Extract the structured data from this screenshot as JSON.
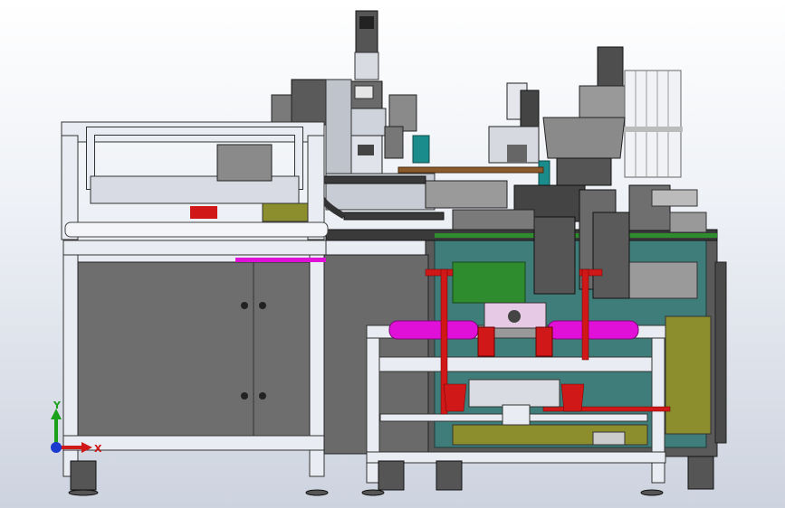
{
  "view": {
    "axis_y_label": "Y",
    "axis_x_label": "X"
  },
  "colors": {
    "frame_white": "#e9ecf2",
    "cabinet_gray": "#6e6e6e",
    "teal": "#3f7d7a",
    "olive": "#8c8d2c",
    "magenta": "#e010d8",
    "red": "#d01818",
    "dark_gray": "#4a4a4a",
    "green": "#2e8b2e",
    "brown": "#8b5a2b",
    "cyan": "#1a8c8c",
    "axis_y": "#1aa01a",
    "axis_x": "#d01818",
    "axis_z": "#1a3ad0"
  }
}
